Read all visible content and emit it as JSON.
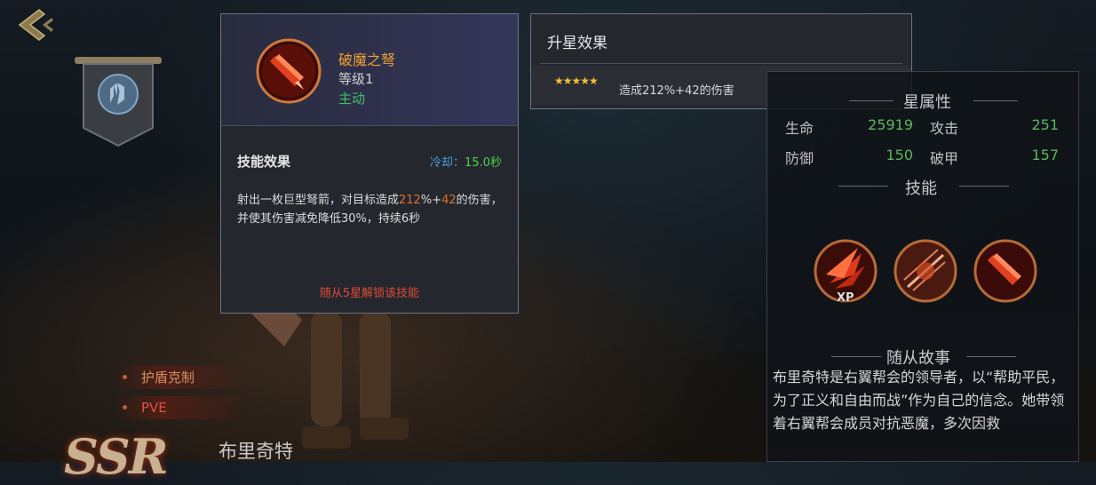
{
  "hero": {
    "name": "布里奇特",
    "tags": [
      "护盾克制",
      "PVE"
    ],
    "rank_logo": "SSR"
  },
  "skill_popup": {
    "name": "破魔之弩",
    "level": "等级1",
    "type": "主动",
    "effect_title": "技能效果",
    "cooldown_label": "冷却：",
    "cooldown_value": "15.0秒",
    "desc_part1": "射出一枚巨型弩箭，对目标造成",
    "desc_pct": "212",
    "desc_part2": "%+",
    "desc_flat": "42",
    "desc_part3": "的伤害，并使其伤害减免降低30%，持续6秒",
    "unlock_text": "随从5星解锁该技能"
  },
  "star_popup": {
    "title": "升星效果",
    "stars": "★★★★★",
    "desc": "造成212%+42的伤害"
  },
  "right_panel": {
    "attr_title": "星属性",
    "stats": [
      {
        "label": "生命",
        "value": "25919"
      },
      {
        "label": "攻击",
        "value": "251"
      },
      {
        "label": "防御",
        "value": "150"
      },
      {
        "label": "破甲",
        "value": "157"
      }
    ],
    "skills_title": "技能",
    "xp_label": "XP",
    "story_title": "随从故事",
    "story_text": "布里奇特是右翼帮会的领导者，以“帮助平民，为了正义和自由而战”作为自己的信念。她带领着右翼帮会成员对抗恶魔，多次因救"
  },
  "colors": {
    "accent_orange": "#f0a030",
    "active_green": "#41c06a",
    "stat_green": "#5ab85a",
    "unlock_red": "#e04a3a",
    "cooldown_blue": "#4a9ede"
  }
}
